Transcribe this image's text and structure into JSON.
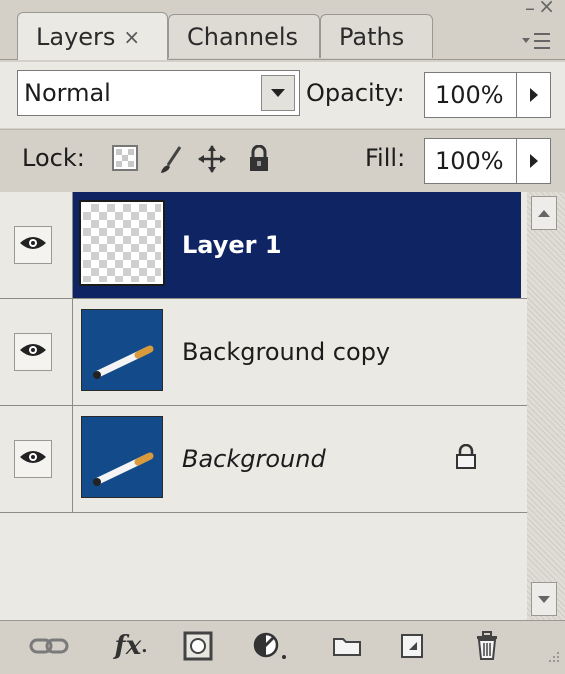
{
  "panel": {
    "tabs": [
      {
        "label": "Layers",
        "close": "×"
      },
      {
        "label": "Channels"
      },
      {
        "label": "Paths"
      }
    ],
    "window_controls": {
      "minimize": "–",
      "close": "×"
    },
    "menu_icon": "panel-menu-icon"
  },
  "blend": {
    "mode": "Normal",
    "opacity_label": "Opacity:",
    "opacity_value": "100%"
  },
  "lock": {
    "label": "Lock:",
    "icons": [
      "lock-transparent-pixels-icon",
      "lock-image-pixels-icon",
      "lock-position-icon",
      "lock-all-icon"
    ],
    "fill_label": "Fill:",
    "fill_value": "100%"
  },
  "layers": [
    {
      "name": "Layer 1",
      "selected": true,
      "visible": true,
      "thumbnail": "transparent"
    },
    {
      "name": "Background copy",
      "selected": false,
      "visible": true,
      "thumbnail": "cigarette"
    },
    {
      "name": "Background",
      "selected": false,
      "visible": true,
      "thumbnail": "cigarette",
      "locked": true,
      "italic": true
    }
  ],
  "toolbar": {
    "icons": [
      "link-layers-icon",
      "fx-icon",
      "add-mask-icon",
      "adjustment-layer-icon",
      "new-group-icon",
      "new-layer-icon",
      "trash-icon"
    ],
    "fx_label": "fx"
  },
  "colors": {
    "selection": "#0f2463",
    "thumbnail_bg": "#124a8a",
    "panel_bg": "#d4d0c8"
  }
}
